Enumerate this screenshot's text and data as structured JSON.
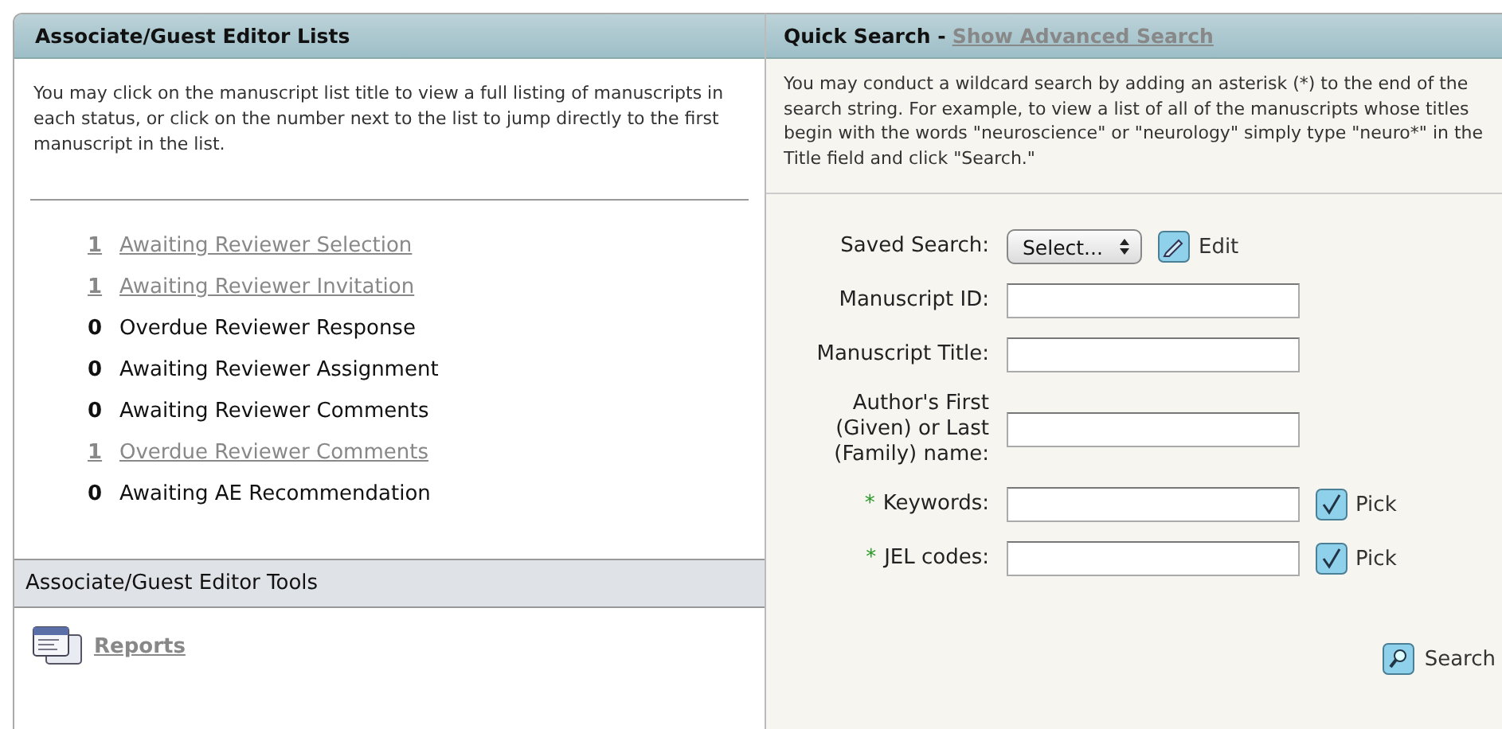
{
  "left_panel": {
    "title": "Associate/Guest Editor Lists",
    "intro": "You may click on the manuscript list title to view a full listing of manuscripts in each status, or click on the number next to the list to jump directly to the first manuscript in the list.",
    "lists": [
      {
        "count": "1",
        "label": "Awaiting Reviewer Selection",
        "linked": true
      },
      {
        "count": "1",
        "label": "Awaiting Reviewer Invitation",
        "linked": true
      },
      {
        "count": "0",
        "label": "Overdue Reviewer Response",
        "linked": false
      },
      {
        "count": "0",
        "label": "Awaiting Reviewer Assignment",
        "linked": false
      },
      {
        "count": "0",
        "label": "Awaiting Reviewer Comments",
        "linked": false
      },
      {
        "count": "1",
        "label": "Overdue Reviewer Comments",
        "linked": true
      },
      {
        "count": "0",
        "label": "Awaiting AE Recommendation",
        "linked": false
      }
    ],
    "tools_title": "Associate/Guest Editor Tools",
    "tools": [
      {
        "label": "Reports"
      }
    ]
  },
  "quick_search": {
    "title": "Quick Search -",
    "advanced_link": "Show Advanced Search",
    "intro": "You may conduct a wildcard search by adding an asterisk (*) to the end of the search string. For example, to view a list of all of the manuscripts whose titles begin with the words \"neuroscience\" or \"neurology\" simply type \"neuro*\" in the Title field and click \"Search.\"",
    "fields": [
      {
        "kind": "select",
        "label": "Saved Search:",
        "value": "Select...",
        "action": "Edit",
        "required": false
      },
      {
        "kind": "text",
        "label": "Manuscript ID:",
        "required": false
      },
      {
        "kind": "text",
        "label": "Manuscript Title:",
        "required": false
      },
      {
        "kind": "text",
        "label": "Author's First (Given) or Last (Family) name:",
        "required": false
      },
      {
        "kind": "text",
        "label": "Keywords:",
        "action": "Pick",
        "required": true
      },
      {
        "kind": "text",
        "label": "JEL codes:",
        "action": "Pick",
        "required": true
      }
    ],
    "required_mark": "*",
    "search_button": "Search"
  }
}
